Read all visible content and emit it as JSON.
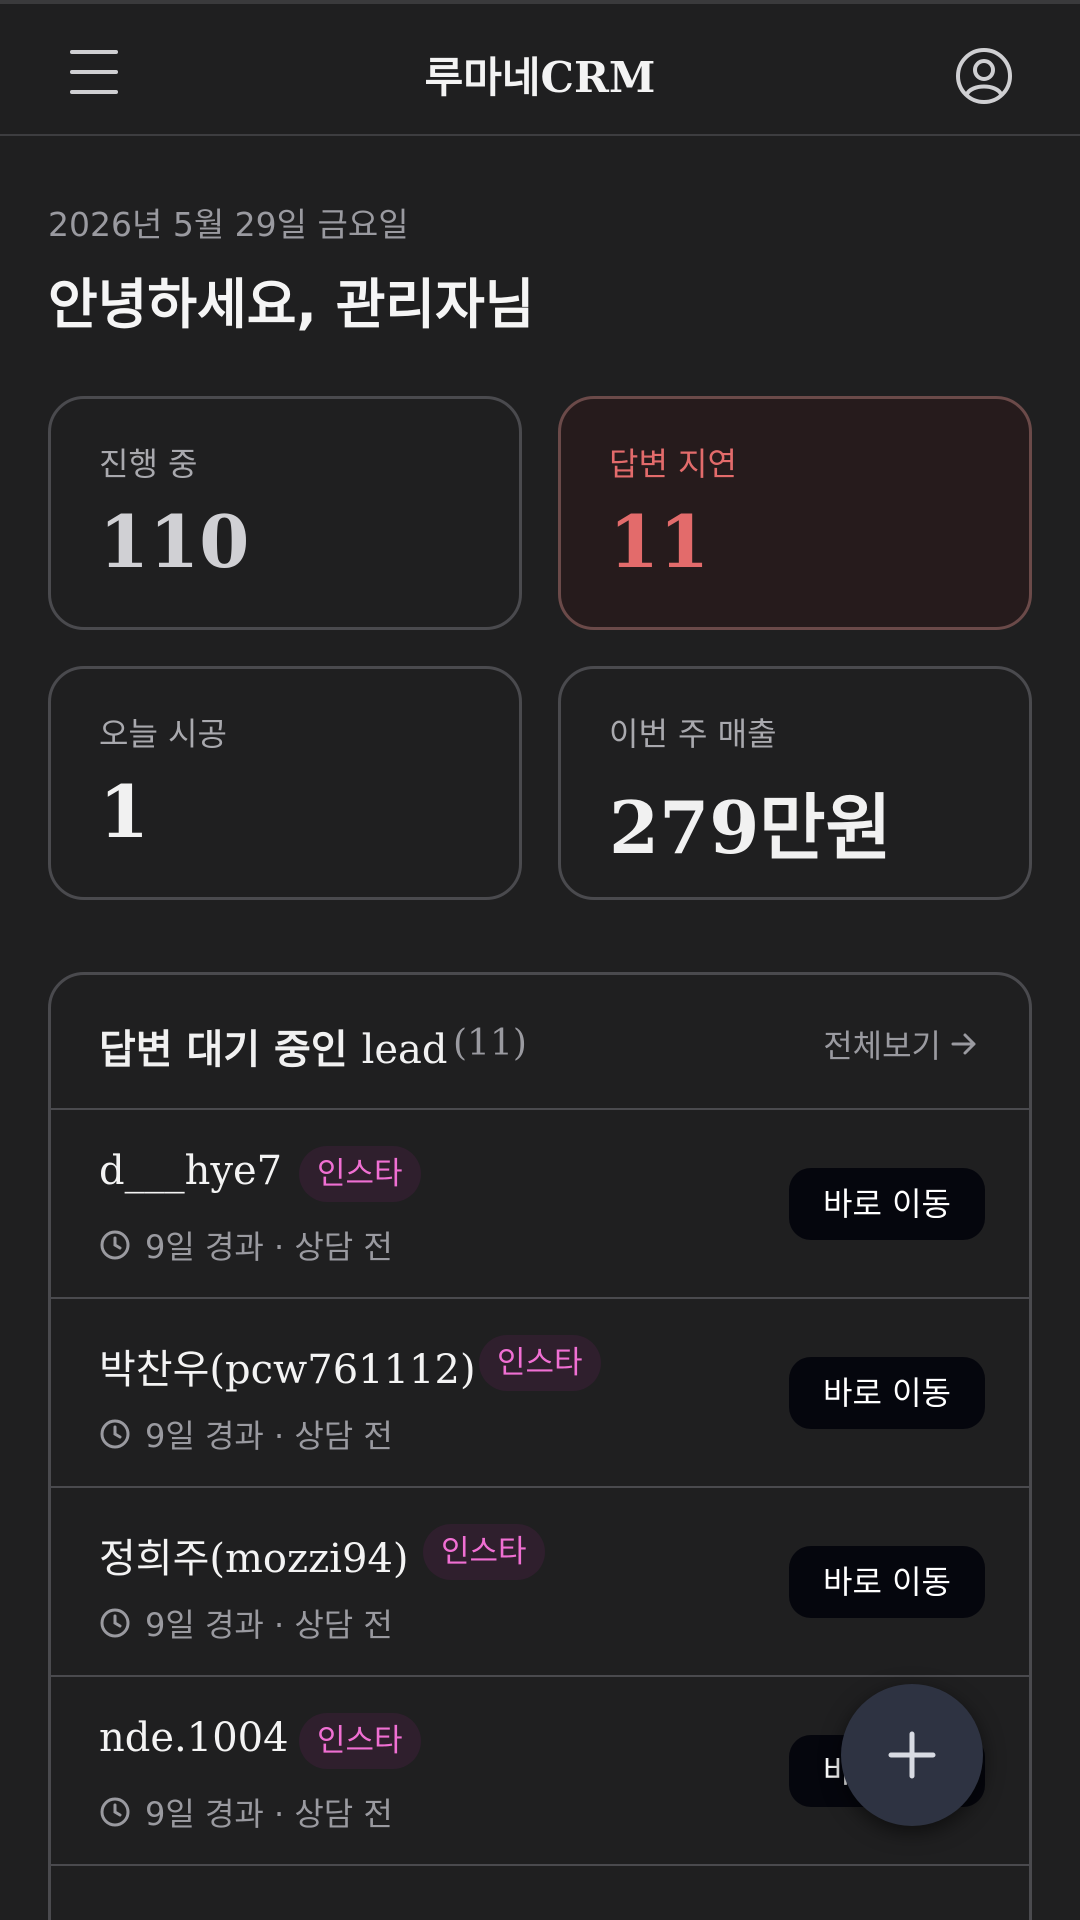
{
  "header": {
    "title": "루마네CRM",
    "menu_icon": "hamburger-menu-icon",
    "profile_icon": "user-profile-icon"
  },
  "greeting": {
    "date": "2026년 5월 29일 금요일",
    "text": "안녕하세요, 관리자님"
  },
  "stats": [
    {
      "label": "진행 중",
      "value": "110"
    },
    {
      "label": "답변 지연",
      "value": "11",
      "alert_color": "#e36b6b"
    },
    {
      "label": "오늘 시공",
      "value": "1"
    },
    {
      "label": "이번 주 매출",
      "value": "279만원"
    }
  ],
  "leads_panel": {
    "title_ko": "답변 대기 중인",
    "title_en": "lead",
    "count": "(11)",
    "view_all": "전체보기",
    "items": [
      {
        "name": "d___hye7",
        "tag": "인스타",
        "meta": "9일 경과 · 상담 전",
        "action": "바로 이동"
      },
      {
        "name": "박찬우(pcw761112)",
        "tag": "인스타",
        "meta": "9일 경과 · 상담 전",
        "action": "바로 이동"
      },
      {
        "name": "정희주(mozzi94)",
        "tag": "인스타",
        "meta": "9일 경과 · 상담 전",
        "action": "바로 이동"
      },
      {
        "name": "nde.1004",
        "tag": "인스타",
        "meta": "9일 경과 · 상담 전",
        "action": "바로 이동"
      }
    ]
  },
  "fab": {
    "icon": "plus-icon"
  },
  "colors": {
    "background": "#1f1f20",
    "alert": "#e36b6b",
    "tag_text": "#f06fd3",
    "button_bg": "#05060d"
  }
}
